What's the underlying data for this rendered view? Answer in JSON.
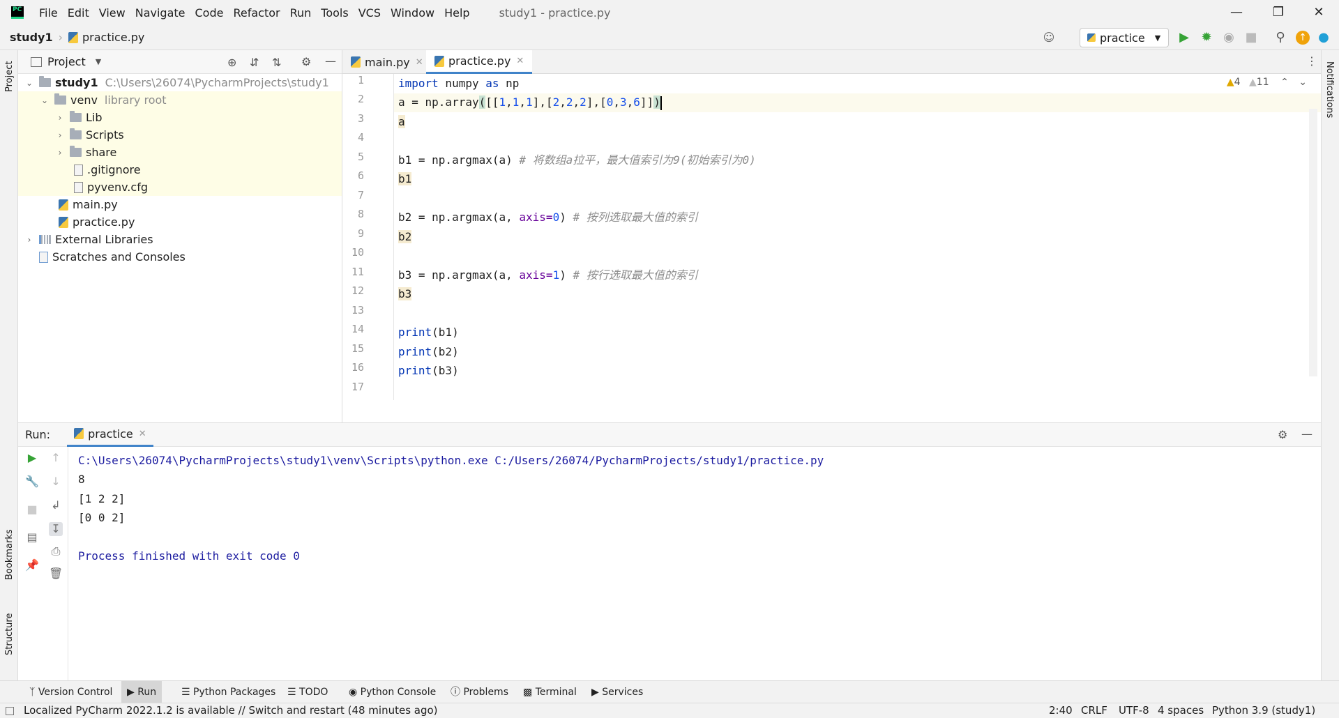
{
  "menubar": {
    "items": [
      "File",
      "Edit",
      "View",
      "Navigate",
      "Code",
      "Refactor",
      "Run",
      "Tools",
      "VCS",
      "Window",
      "Help"
    ],
    "window_title": "study1 - practice.py"
  },
  "navbar": {
    "project": "study1",
    "file": "practice.py",
    "run_config": "practice"
  },
  "project_panel": {
    "title": "Project",
    "tree": [
      {
        "label": "study1",
        "path": "C:\\Users\\26074\\PycharmProjects\\study1"
      },
      {
        "label": "venv",
        "path": "library root"
      },
      {
        "label": "Lib"
      },
      {
        "label": "Scripts"
      },
      {
        "label": "share"
      },
      {
        "label": ".gitignore"
      },
      {
        "label": "pyvenv.cfg"
      },
      {
        "label": "main.py"
      },
      {
        "label": "practice.py"
      },
      {
        "label": "External Libraries"
      },
      {
        "label": "Scratches and Consoles"
      }
    ]
  },
  "editor": {
    "tabs": [
      "main.py",
      "practice.py"
    ],
    "line_numbers": [
      "1",
      "2",
      "3",
      "4",
      "5",
      "6",
      "7",
      "8",
      "9",
      "10",
      "11",
      "12",
      "13",
      "14",
      "15",
      "16",
      "17"
    ],
    "inspections": {
      "warnings": "4",
      "weak_warnings": "11"
    },
    "code": {
      "l1": {
        "kw": "import",
        "rest": " numpy ",
        "kw2": "as",
        "rest2": " np"
      },
      "l2": {
        "a": "a = np.array",
        "p": "(",
        "b": "[[",
        "n1": "1",
        ",1": ",",
        "n2": "1",
        ",2": ",",
        "n3": "1",
        "c": "],[",
        "n4": "2",
        ",3": ",",
        "n5": "2",
        ",4": ",",
        "n6": "2",
        "d": "],[",
        "n7": "0",
        ",5": ",",
        "n8": "3",
        ",6": ",",
        "n9": "6",
        "e": "]]",
        "p2": ")"
      },
      "l3": "a",
      "l5": {
        "code": "b1 = np.argmax(a) ",
        "comment": "# 将数组a拉平，最大值索引为9(初始索引为0)"
      },
      "l6": "b1",
      "l8": {
        "code": "b2 = np.argmax(a, ",
        "param": "axis=",
        "num": "0",
        "close": ") ",
        "comment": "# 按列选取最大值的索引"
      },
      "l9": "b2",
      "l11": {
        "code": "b3 = np.argmax(a, ",
        "param": "axis=",
        "num": "1",
        "close": ") ",
        "comment": "# 按行选取最大值的索引"
      },
      "l12": "b3",
      "l14": {
        "kw": "print",
        "rest": "(b1)"
      },
      "l15": {
        "kw": "print",
        "rest": "(b2)"
      },
      "l16": {
        "kw": "print",
        "rest": "(b3)"
      }
    }
  },
  "run_panel": {
    "label": "Run:",
    "tab": "practice",
    "output": [
      "C:\\Users\\26074\\PycharmProjects\\study1\\venv\\Scripts\\python.exe C:/Users/26074/PycharmProjects/study1/practice.py",
      "8",
      "[1 2 2]",
      "[0 0 2]",
      "",
      "Process finished with exit code 0"
    ]
  },
  "side_labels": {
    "project": "Project",
    "bookmarks": "Bookmarks",
    "structure": "Structure",
    "notifications": "Notifications"
  },
  "bottom_tabs": [
    "Version Control",
    "Run",
    "Python Packages",
    "TODO",
    "Python Console",
    "Problems",
    "Terminal",
    "Services"
  ],
  "statusbar": {
    "message": "Localized PyCharm 2022.1.2 is available // Switch and restart (48 minutes ago)",
    "position": "2:40",
    "line_sep": "CRLF",
    "encoding": "UTF-8",
    "indent": "4 spaces",
    "interpreter": "Python 3.9 (study1)"
  },
  "colors": {
    "keyword": "#0033b3",
    "number": "#1750eb",
    "comment": "#8c8c8c",
    "param": "#660099",
    "console_text": "#1c1ca0",
    "accent": "#4083c9"
  }
}
